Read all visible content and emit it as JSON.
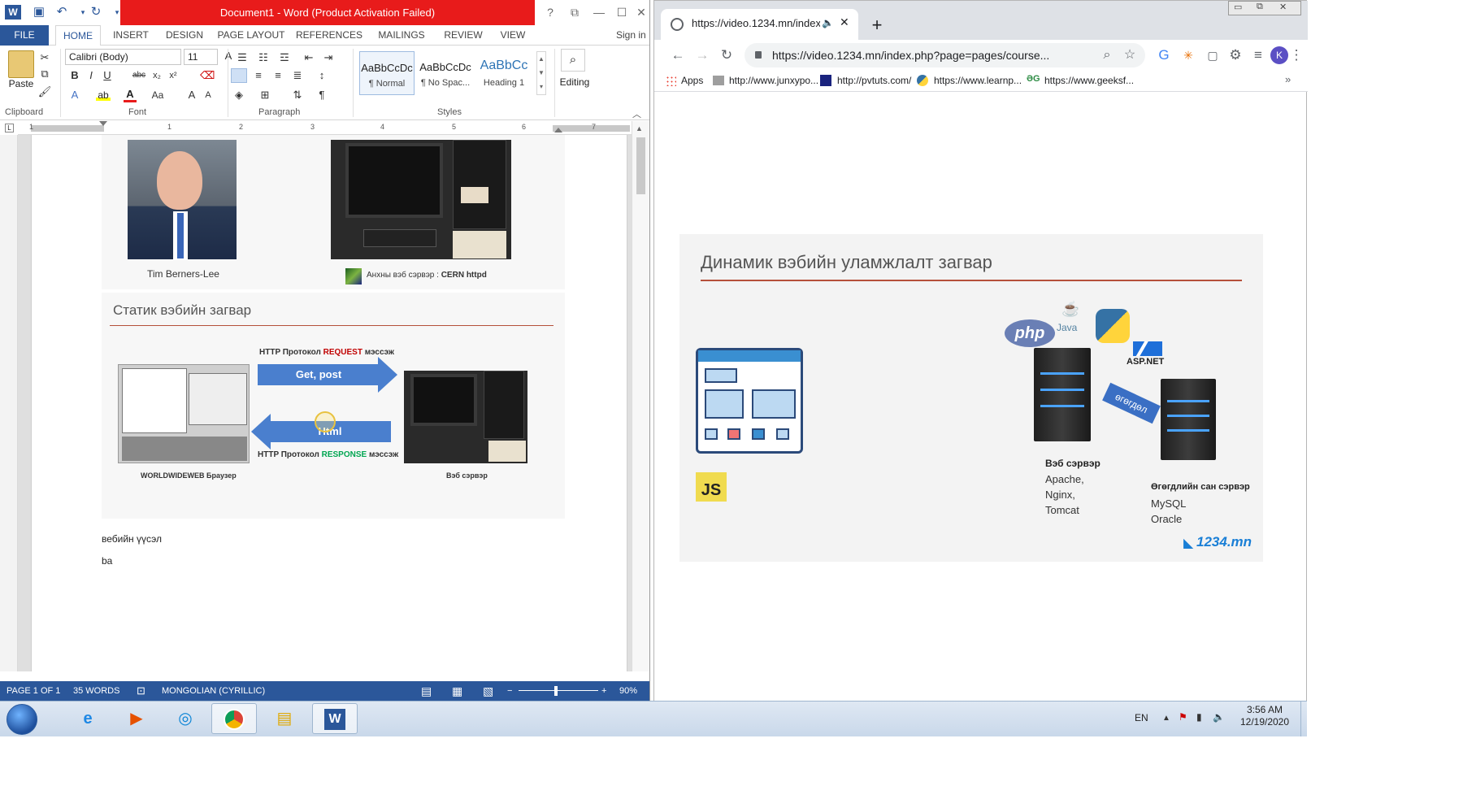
{
  "word": {
    "title": "Document1 - Word (Product Activation Failed)",
    "window_controls": {
      "help": "?",
      "restore_ribbon": "⧉",
      "minimize": "—",
      "maximize": "☐",
      "close": "✕"
    },
    "tabs": [
      "FILE",
      "HOME",
      "INSERT",
      "DESIGN",
      "PAGE LAYOUT",
      "REFERENCES",
      "MAILINGS",
      "REVIEW",
      "VIEW"
    ],
    "sign_in": "Sign in",
    "clipboard": {
      "paste_label": "Paste",
      "group_label": "Clipboard"
    },
    "font": {
      "name": "Calibri (Body)",
      "size": "11",
      "group_label": "Font"
    },
    "paragraph": {
      "group_label": "Paragraph"
    },
    "styles": {
      "items": [
        {
          "sample": "AaBbCcDc",
          "name": "¶ Normal"
        },
        {
          "sample": "AaBbCcDc",
          "name": "¶ No Spac..."
        },
        {
          "sample": "AaBbCc",
          "name": "Heading 1"
        }
      ],
      "group_label": "Styles"
    },
    "editing": {
      "label": "Editing"
    },
    "ruler_numbers": [
      "1",
      "1",
      "2",
      "3",
      "4",
      "5",
      "6",
      "7"
    ],
    "doc": {
      "caption_tim": "Tim Berners-Lee",
      "caption_server_prefix": "Анхны вэб сэрвэр : ",
      "caption_server_bold": "CERN httpd",
      "slide_title": "Статик вэбийн загвар",
      "request_prefix": "HTTP Протокол ",
      "request_word": "REQUEST",
      "request_suffix": " мэссэж",
      "response_prefix": "HTTP Протокол ",
      "response_word": "RESPONSE",
      "response_suffix": " мэссэж",
      "arrow_right_label": "Get, post",
      "arrow_left_label": "Html",
      "browser_caption": "WORLDWIDEWEB Браузер",
      "server_caption": "Вэб сэрвэр",
      "para1": "вебийн үүсэл",
      "para2": "ba"
    },
    "status": {
      "page": "PAGE 1 OF 1",
      "words": "35 WORDS",
      "language": "MONGOLIAN (CYRILLIC)",
      "zoom": "90%"
    }
  },
  "chrome": {
    "tab_title": "https://video.1234.mn/index",
    "new_tab": "+",
    "address": "https://video.1234.mn/index.php?page=pages/course...",
    "profile_initial": "K",
    "bookmarks": [
      "Apps",
      "http://www.junxypo...",
      "http://pvtuts.com/",
      "https://www.learnp...",
      "https://www.geeksf..."
    ],
    "slide": {
      "title": "Динамик вэбийн уламжлалт загвар",
      "php": "php",
      "java": "Java",
      "aspnet": "ASP.NET",
      "js": "JS",
      "data_arrow": "өгөгдөл",
      "web_server_title": "Вэб сэрвэр",
      "web_servers": [
        "Apache,",
        "Nginx,",
        "Tomcat"
      ],
      "db_server_title": "Өгөгдлийн сан сэрвэр",
      "db_servers": [
        "MySQL",
        "Oracle"
      ],
      "brand": "1234.mn"
    }
  },
  "taskbar": {
    "lang": "EN",
    "time": "3:56 AM",
    "date": "12/19/2020"
  },
  "colors": {
    "word_blue": "#2b579a",
    "title_red": "#e81b1b",
    "request_red": "#c00000",
    "response_green": "#00a651",
    "slide_rule": "#b5503a"
  }
}
